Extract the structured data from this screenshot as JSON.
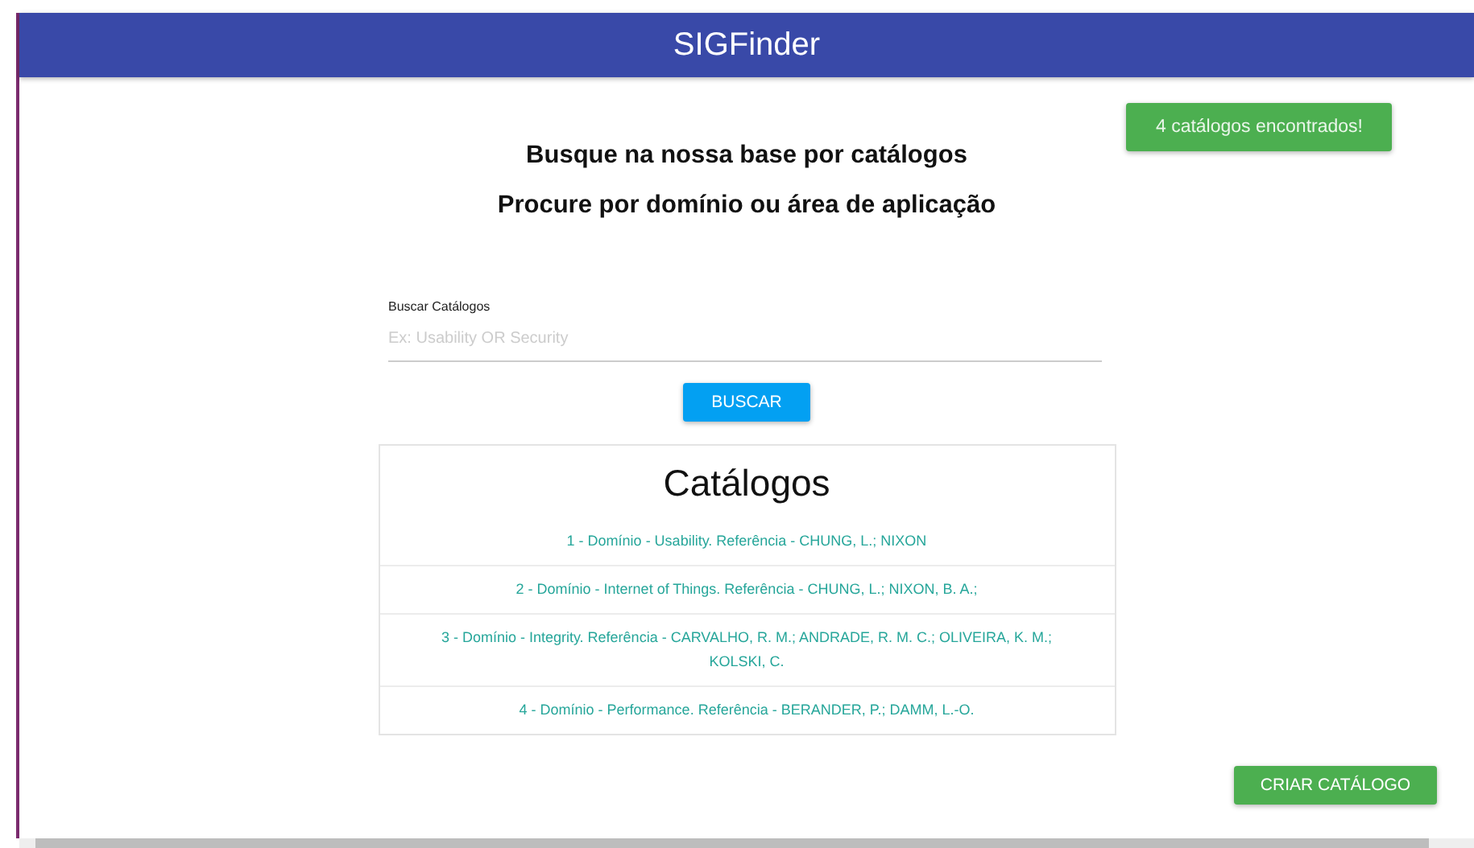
{
  "header": {
    "title": "SIGFinder"
  },
  "notification": {
    "text": "4 catálogos encontrados!"
  },
  "headings": [
    "Busque na nossa base por catálogos",
    "Procure por domínio ou área de aplicação"
  ],
  "search": {
    "label": "Buscar Catálogos",
    "placeholder": "Ex: Usability OR Security"
  },
  "search_button": "BUSCAR",
  "catalogs": {
    "title": "Catálogos",
    "items": [
      "1 - Domínio - Usability. Referência - CHUNG, L.; NIXON",
      "2 - Domínio - Internet of Things. Referência - CHUNG, L.; NIXON, B. A.;",
      "3 - Domínio - Integrity. Referência - CARVALHO, R. M.; ANDRADE, R. M. C.; OLIVEIRA, K. M.; KOLSKI, C.",
      "4 - Domínio - Performance. Referência - BERANDER, P.; DAMM, L.-O."
    ]
  },
  "create_button": "CRIAR CATÁLOGO"
}
